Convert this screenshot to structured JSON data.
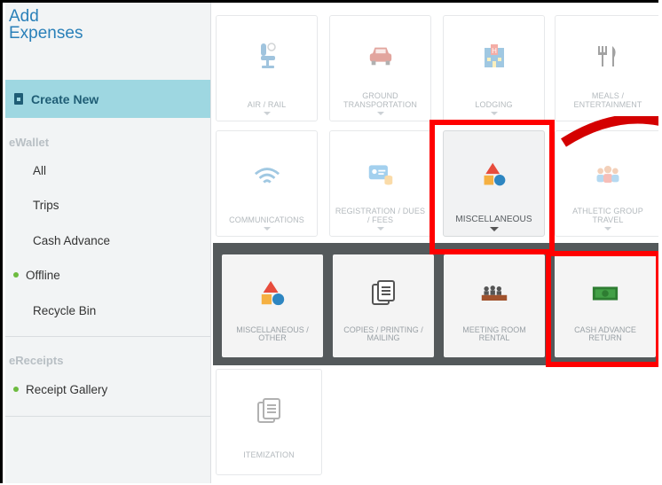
{
  "sidebar": {
    "title_line1": "Add",
    "title_line2": "Expenses",
    "create_new": "Create New",
    "ewallet_header": "eWallet",
    "items": [
      {
        "label": "All"
      },
      {
        "label": "Trips"
      },
      {
        "label": "Cash Advance"
      },
      {
        "label": "Offline"
      },
      {
        "label": "Recycle Bin"
      }
    ],
    "ereceipts_header": "eReceipts",
    "receipt_gallery": "Receipt Gallery"
  },
  "categories_row1": [
    {
      "l1": "",
      "l2": "AIR / RAIL",
      "icon": "airline-seat-icon"
    },
    {
      "l1": "GROUND",
      "l2": "TRANSPORTATION",
      "icon": "car-icon"
    },
    {
      "l1": "",
      "l2": "LODGING",
      "icon": "hotel-icon"
    },
    {
      "l1": "MEALS /",
      "l2": "ENTERTAINMENT",
      "icon": "fork-knife-icon"
    }
  ],
  "categories_row2": [
    {
      "l1": "",
      "l2": "COMMUNICATIONS",
      "icon": "wifi-icon"
    },
    {
      "l1": "REGISTRATION / DUES",
      "l2": "/ FEES",
      "icon": "id-card-icon"
    },
    {
      "l1": "",
      "l2": "MISCELLANEOUS",
      "icon": "shapes-icon"
    },
    {
      "l1": "ATHLETIC GROUP",
      "l2": "TRAVEL",
      "icon": "group-icon"
    }
  ],
  "subcategories": [
    {
      "l1": "MISCELLANEOUS /",
      "l2": "OTHER",
      "icon": "shapes-icon"
    },
    {
      "l1": "COPIES / PRINTING /",
      "l2": "MAILING",
      "icon": "copies-icon"
    },
    {
      "l1": "MEETING ROOM",
      "l2": "RENTAL",
      "icon": "meeting-room-icon"
    },
    {
      "l1": "CASH ADVANCE",
      "l2": "RETURN",
      "icon": "cash-icon"
    }
  ],
  "itemization": {
    "label": "ITEMIZATION",
    "icon": "itemization-icon"
  },
  "colors": {
    "accent": "#2a80b9",
    "create_new_bg": "#9ed7e1",
    "highlight": "#ff0000",
    "offline_dot": "#6dbb3f"
  }
}
